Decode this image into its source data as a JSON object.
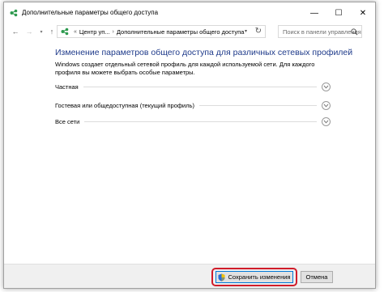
{
  "window": {
    "title": "Дополнительные параметры общего доступа",
    "minimize_glyph": "—",
    "maximize_glyph": "☐",
    "close_glyph": "✕"
  },
  "nav": {
    "back_glyph": "←",
    "forward_glyph": "→",
    "history_glyph": "▾",
    "up_glyph": "↑",
    "breadcrumb_prefix": "«",
    "breadcrumbs": [
      "Центр уп...",
      "Дополнительные параметры общего доступа"
    ],
    "crumb_separator": "›",
    "dropdown_glyph": "▾",
    "refresh_glyph": "↻",
    "search_placeholder": "Поиск в панели управления"
  },
  "main": {
    "title": "Изменение параметров общего доступа для различных сетевых профилей",
    "description": "Windows создает отдельный сетевой профиль для каждой используемой сети. Для каждого профиля вы можете выбрать особые параметры.",
    "sections": [
      {
        "label": "Частная"
      },
      {
        "label": "Гостевая или общедоступная (текущий профиль)"
      },
      {
        "label": "Все сети"
      }
    ]
  },
  "footer": {
    "save_label": "Сохранить изменения",
    "cancel_label": "Отмена"
  },
  "colors": {
    "title_blue": "#1e3a8a",
    "highlight_red": "#d01c2a",
    "focus_blue": "#0078d7",
    "icon_green": "#2e9a4f"
  },
  "icons": [
    "network-sharing-icon",
    "shield-icon",
    "chevron-down-icon",
    "search-icon",
    "refresh-icon"
  ]
}
